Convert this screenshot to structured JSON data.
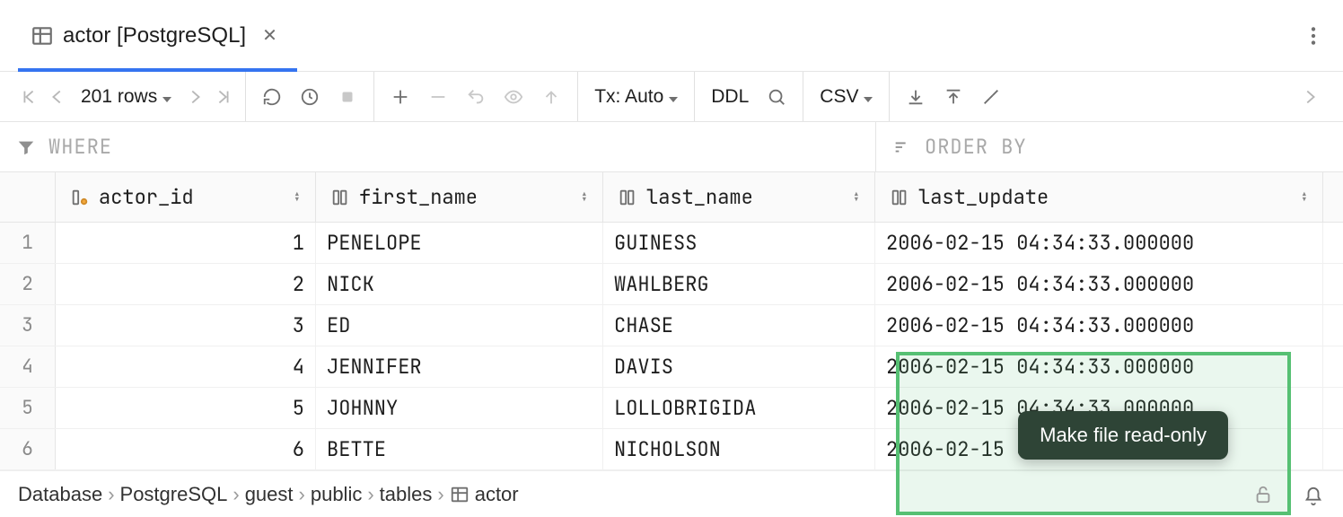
{
  "tab": {
    "title": "actor [PostgreSQL]"
  },
  "toolbar": {
    "rows_label": "201 rows",
    "tx_label": "Tx: Auto",
    "ddl_label": "DDL",
    "csv_label": "CSV"
  },
  "filter": {
    "where_label": "WHERE",
    "orderby_label": "ORDER BY"
  },
  "columns": [
    {
      "name": "actor_id"
    },
    {
      "name": "first_name"
    },
    {
      "name": "last_name"
    },
    {
      "name": "last_update"
    }
  ],
  "rows": [
    {
      "n": "1",
      "actor_id": "1",
      "first_name": "PENELOPE",
      "last_name": "GUINESS",
      "last_update": "2006-02-15 04:34:33.000000"
    },
    {
      "n": "2",
      "actor_id": "2",
      "first_name": "NICK",
      "last_name": "WAHLBERG",
      "last_update": "2006-02-15 04:34:33.000000"
    },
    {
      "n": "3",
      "actor_id": "3",
      "first_name": "ED",
      "last_name": "CHASE",
      "last_update": "2006-02-15 04:34:33.000000"
    },
    {
      "n": "4",
      "actor_id": "4",
      "first_name": "JENNIFER",
      "last_name": "DAVIS",
      "last_update": "2006-02-15 04:34:33.000000"
    },
    {
      "n": "5",
      "actor_id": "5",
      "first_name": "JOHNNY",
      "last_name": "LOLLOBRIGIDA",
      "last_update": "2006-02-15 04:34:33.000000"
    },
    {
      "n": "6",
      "actor_id": "6",
      "first_name": "BETTE",
      "last_name": "NICHOLSON",
      "last_update": "2006-02-15 04:34:33.000000"
    }
  ],
  "breadcrumbs": [
    "Database",
    "PostgreSQL",
    "guest",
    "public",
    "tables",
    "actor"
  ],
  "tooltip": {
    "text": "Make file read-only"
  }
}
